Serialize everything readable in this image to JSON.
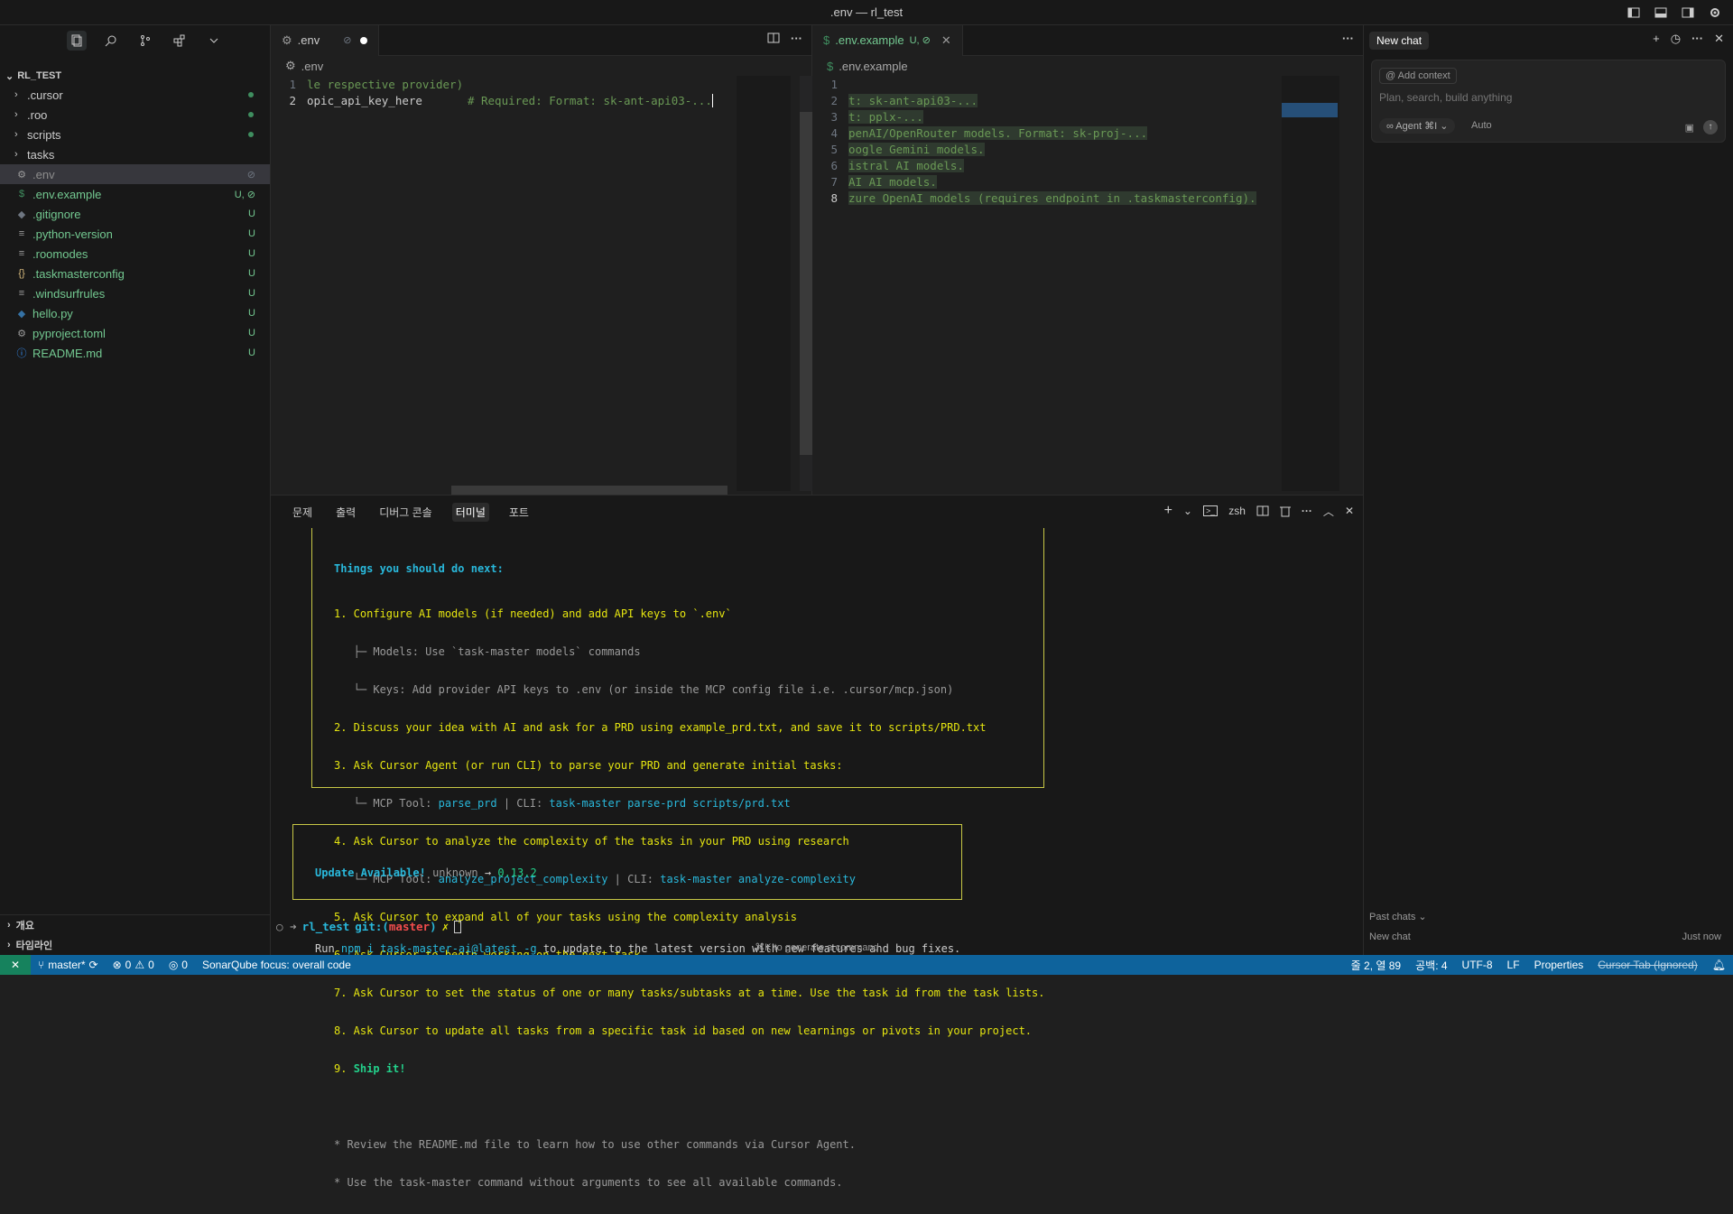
{
  "titlebar": {
    "title": ".env — rl_test"
  },
  "explorer": {
    "root": "RL_TEST",
    "items": [
      {
        "name": ".cursor",
        "kind": "folder",
        "badge": "",
        "dot": true
      },
      {
        "name": ".roo",
        "kind": "folder",
        "badge": "",
        "dot": true
      },
      {
        "name": "scripts",
        "kind": "folder",
        "badge": "",
        "dot": true
      },
      {
        "name": "tasks",
        "kind": "folder",
        "badge": "",
        "dot": false
      },
      {
        "name": ".env",
        "kind": "file",
        "icon": "gear",
        "badge": "⊘",
        "dot": false
      },
      {
        "name": ".env.example",
        "kind": "file",
        "icon": "$",
        "badge": "U, ⊘",
        "dot": false
      },
      {
        "name": ".gitignore",
        "kind": "file",
        "icon": "◆",
        "badge": "U",
        "dot": false
      },
      {
        "name": ".python-version",
        "kind": "file",
        "icon": "≡",
        "badge": "U",
        "dot": false
      },
      {
        "name": ".roomodes",
        "kind": "file",
        "icon": "≡",
        "badge": "U",
        "dot": false
      },
      {
        "name": ".taskmasterconfig",
        "kind": "file",
        "icon": "{}",
        "badge": "U",
        "dot": false
      },
      {
        "name": ".windsurfrules",
        "kind": "file",
        "icon": "≡",
        "badge": "U",
        "dot": false
      },
      {
        "name": "hello.py",
        "kind": "file",
        "icon": "py",
        "badge": "U",
        "dot": false
      },
      {
        "name": "pyproject.toml",
        "kind": "file",
        "icon": "gear",
        "badge": "U",
        "dot": false
      },
      {
        "name": "README.md",
        "kind": "file",
        "icon": "ⓘ",
        "badge": "U",
        "dot": false
      }
    ],
    "outline": "개요",
    "timeline": "타임라인"
  },
  "editor1": {
    "tab": ".env",
    "tab_badge": "⊘",
    "crumb": ".env",
    "lines": [
      {
        "n": "1",
        "text": "le respective provider)"
      },
      {
        "n": "2",
        "text": "opic_api_key_here",
        "comment": "# Required: Format: sk-ant-api03-..."
      }
    ]
  },
  "editor2": {
    "tab": ".env.example",
    "tab_badge": "U, ⊘",
    "crumb": ".env.example",
    "lines": [
      {
        "n": "1",
        "text": ""
      },
      {
        "n": "2",
        "text": "t: sk-ant-api03-..."
      },
      {
        "n": "3",
        "text": "t: pplx-..."
      },
      {
        "n": "4",
        "text": "penAI/OpenRouter models. Format: sk-proj-..."
      },
      {
        "n": "5",
        "text": "oogle Gemini models."
      },
      {
        "n": "6",
        "text": "istral AI models."
      },
      {
        "n": "7",
        "text": "AI AI models."
      },
      {
        "n": "8",
        "text": "zure OpenAI models (requires endpoint in .taskmasterconfig)."
      }
    ]
  },
  "panel": {
    "tabs": [
      "문제",
      "출력",
      "디버그 콘솔",
      "터미널",
      "포트"
    ],
    "active_tab": "터미널",
    "shell": "zsh",
    "heading": "Things you should do next:",
    "steps": {
      "s1": "1. Configure AI models (if needed) and add API keys to `.env`",
      "s1a": "   ├─ Models: Use `task-master models` commands",
      "s1b": "   └─ Keys: Add provider API keys to .env (or inside the MCP config file i.e. .cursor/mcp.json)",
      "s2": "2. Discuss your idea with AI and ask for a PRD using example_prd.txt, and save it to scripts/PRD.txt",
      "s3": "3. Ask Cursor Agent (or run CLI) to parse your PRD and generate initial tasks:",
      "s3a_pre": "   └─ MCP Tool: ",
      "s3a_tool": "parse_prd",
      "s3a_mid": " | CLI: ",
      "s3a_cli": "task-master parse-prd scripts/prd.txt",
      "s4": "4. Ask Cursor to analyze the complexity of the tasks in your PRD using research",
      "s4a_pre": "   └─ MCP Tool: ",
      "s4a_tool": "analyze_project_complexity",
      "s4a_mid": " | CLI: ",
      "s4a_cli": "task-master analyze-complexity",
      "s5": "5. Ask Cursor to expand all of your tasks using the complexity analysis",
      "s6": "6. Ask Cursor to begin working on the next task",
      "s7": "7. Ask Cursor to set the status of one or many tasks/subtasks at a time. Use the task id from the task lists.",
      "s8": "8. Ask Cursor to update all tasks from a specific task id based on new learnings or pivots in your project.",
      "s9_num": "9. ",
      "s9": "Ship it!",
      "n1": "* Review the README.md file to learn how to use other commands via Cursor Agent.",
      "n2": "* Use the task-master command without arguments to see all available commands."
    },
    "update": {
      "label": "Update Available!",
      "from": "unknown",
      "arrow": "→",
      "to": "0.13.2",
      "run": "Run",
      "cmd": "npm i task-master-ai@latest -g",
      "rest": "to update to the latest version with new features and bug fixes."
    },
    "prompt": {
      "arrow": "○ ➜",
      "dir": "rl_test",
      "git": "git:(",
      "branch": "master",
      ")": ")",
      "x": "✗"
    },
    "hint": "⌘K to generate a command"
  },
  "chat": {
    "tab": "New chat",
    "add_context": "Add context",
    "placeholder": "Plan, search, build anything",
    "agent": "∞ Agent ⌘I ⌄",
    "mode": "Auto",
    "past": "Past chats ⌄",
    "past_item": "New chat",
    "past_time": "Just now"
  },
  "status": {
    "branch": "master*",
    "errors": "0",
    "warnings": "0",
    "ports": "0",
    "sonar": "SonarQube focus: overall code",
    "position": "줄 2, 열 89",
    "spaces": "공백: 4",
    "encoding": "UTF-8",
    "eol": "LF",
    "lang": "Properties",
    "cursor_tab": "Cursor Tab (Ignored)"
  },
  "colors": {
    "accent": "#0e639c",
    "remote": "#16825d",
    "terminal_border": "#c8c846"
  }
}
